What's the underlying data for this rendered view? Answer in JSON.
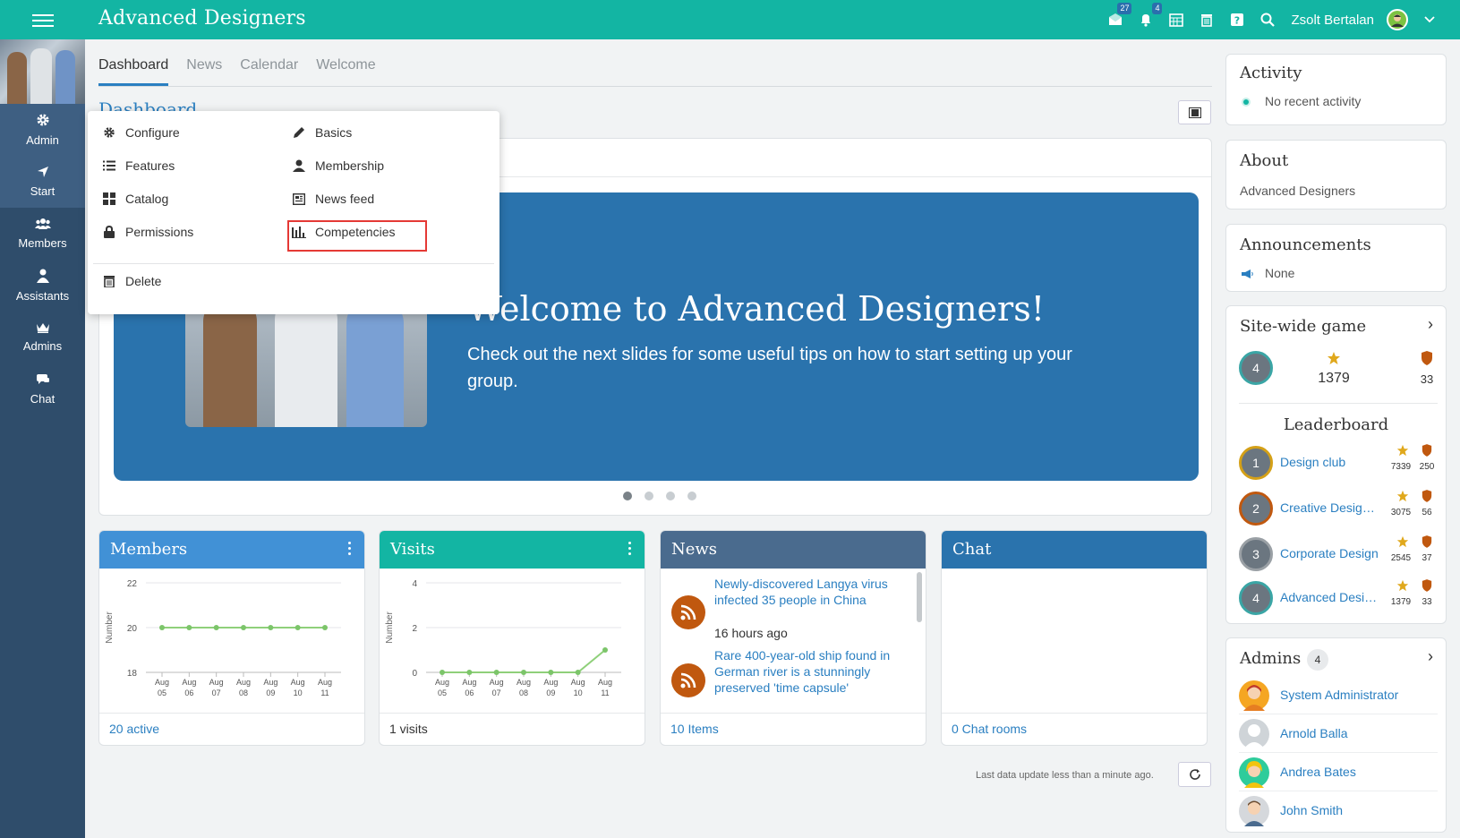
{
  "app": {
    "title": "Advanced Designers"
  },
  "topbar": {
    "mail_badge": "27",
    "notif_badge": "4",
    "user_name": "Zsolt Bertalan"
  },
  "sidebar": {
    "items": [
      {
        "label": "Admin"
      },
      {
        "label": "Start"
      },
      {
        "label": "Members"
      },
      {
        "label": "Assistants"
      },
      {
        "label": "Admins"
      },
      {
        "label": "Chat"
      }
    ]
  },
  "tabs": [
    {
      "label": "Dashboard"
    },
    {
      "label": "News"
    },
    {
      "label": "Calendar"
    },
    {
      "label": "Welcome"
    }
  ],
  "page_title": "Dashboard",
  "dropdown": {
    "left": [
      {
        "label": "Configure",
        "icon": "gear-icon"
      },
      {
        "label": "Features",
        "icon": "list-icon"
      },
      {
        "label": "Catalog",
        "icon": "grid-icon"
      },
      {
        "label": "Permissions",
        "icon": "lock-icon"
      }
    ],
    "right": [
      {
        "label": "Basics",
        "icon": "pencil-icon"
      },
      {
        "label": "Membership",
        "icon": "person-icon"
      },
      {
        "label": "News feed",
        "icon": "newspaper-icon"
      },
      {
        "label": "Competencies",
        "icon": "bar-chart-icon"
      }
    ],
    "delete": {
      "label": "Delete",
      "icon": "trash-icon"
    }
  },
  "slide": {
    "title": "Welcome to Advanced Designers!",
    "subtitle": "Check out the next slides for some useful tips on how to start setting up your group."
  },
  "widgets": {
    "members": {
      "title": "Members",
      "footer": "20 active",
      "color": "#4191d6",
      "ylabel": "Number"
    },
    "visits": {
      "title": "Visits",
      "footer": "1 visits",
      "color": "#13b5a3",
      "ylabel": "Number"
    },
    "news": {
      "title": "News",
      "footer": "10 Items",
      "color": "#4a6b8e",
      "items": [
        {
          "text": "Newly-discovered Langya virus infected 35 people in China",
          "time": "16 hours ago"
        },
        {
          "text": "Rare 400-year-old ship found in German river is a stunningly preserved 'time capsule'"
        }
      ]
    },
    "chat": {
      "title": "Chat",
      "footer": "0 Chat rooms",
      "color": "#2a73ad"
    }
  },
  "chart_data": [
    {
      "type": "line",
      "x": [
        "Aug 05",
        "Aug 06",
        "Aug 07",
        "Aug 08",
        "Aug 09",
        "Aug 10",
        "Aug 11"
      ],
      "series": [
        {
          "values": [
            20,
            20,
            20,
            20,
            20,
            20,
            20
          ]
        }
      ],
      "ylabel": "Number",
      "yticks": [
        18,
        20,
        22
      ],
      "ylim": [
        18,
        22
      ],
      "grid": true
    },
    {
      "type": "line",
      "x": [
        "Aug 05",
        "Aug 06",
        "Aug 07",
        "Aug 08",
        "Aug 09",
        "Aug 10",
        "Aug 11"
      ],
      "series": [
        {
          "values": [
            0,
            0,
            0,
            0,
            0,
            0,
            1
          ]
        }
      ],
      "ylabel": "Number",
      "yticks": [
        0,
        2,
        4
      ],
      "ylim": [
        0,
        4
      ],
      "grid": true
    }
  ],
  "last_update": "Last data update less than a minute ago.",
  "right": {
    "activity": {
      "title": "Activity",
      "text": "No recent activity"
    },
    "about": {
      "title": "About",
      "text": "Advanced Designers"
    },
    "announcements": {
      "title": "Announcements",
      "text": "None"
    },
    "game": {
      "title": "Site-wide game",
      "rank": "4",
      "points": "1379",
      "badges": "33",
      "leaderboard_title": "Leaderboard",
      "leaderboard": [
        {
          "rank": "1",
          "name": "Design club",
          "points": "7339",
          "badges": "250"
        },
        {
          "rank": "2",
          "name": "Creative Design ...",
          "points": "3075",
          "badges": "56"
        },
        {
          "rank": "3",
          "name": "Corporate Design",
          "points": "2545",
          "badges": "37"
        },
        {
          "rank": "4",
          "name": "Advanced Desig...",
          "points": "1379",
          "badges": "33"
        }
      ]
    },
    "admins": {
      "title": "Admins",
      "count": "4",
      "list": [
        {
          "name": "System Administrator"
        },
        {
          "name": "Arnold Balla"
        },
        {
          "name": "Andrea Bates"
        },
        {
          "name": "John Smith"
        }
      ]
    }
  }
}
